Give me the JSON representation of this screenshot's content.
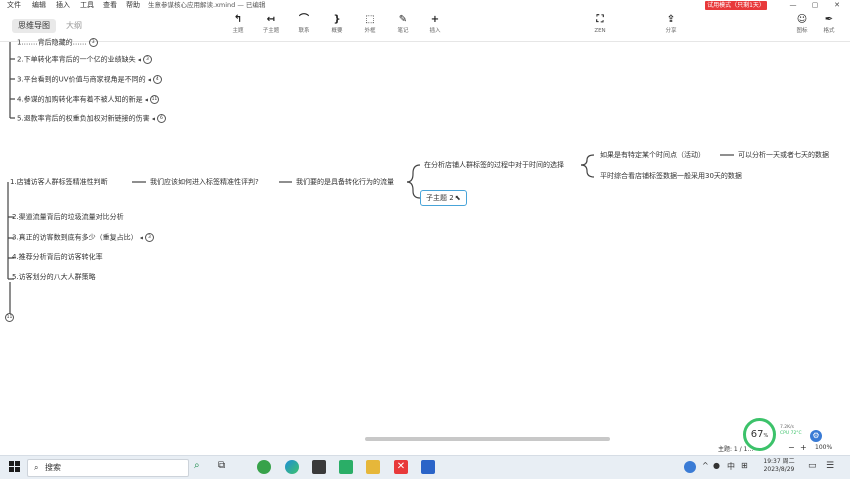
{
  "menubar": {
    "items": [
      "文件",
      "编辑",
      "插入",
      "工具",
      "查看",
      "帮助"
    ],
    "doc_title": "生意参谋核心应用解读.xmind — 已编辑",
    "trial_badge": "试用模式（只剩1天）",
    "window_controls": [
      "—",
      "▢",
      "✕"
    ]
  },
  "toolbar": {
    "tabs": [
      "思维导图",
      "大纲"
    ],
    "tools": [
      {
        "icon": "↰",
        "label": "主题"
      },
      {
        "icon": "↤",
        "label": "子主题"
      },
      {
        "icon": "⌒",
        "label": "联系"
      },
      {
        "icon": "}",
        "label": "概要"
      },
      {
        "icon": "⬚",
        "label": "外框"
      },
      {
        "icon": "✎",
        "label": "笔记"
      },
      {
        "icon": "+",
        "label": "插入"
      }
    ],
    "zen": {
      "icon": "⛶",
      "label": "ZEN"
    },
    "share": {
      "icon": "⇪",
      "label": "分享"
    },
    "right_tools": [
      {
        "icon": "☺",
        "label": "图标"
      },
      {
        "icon": "✒",
        "label": "格式"
      }
    ]
  },
  "mindmap": {
    "top_branch": [
      {
        "text": "1.……背后隐藏的……",
        "badge": "3"
      },
      {
        "text": "2.下单转化率背后的一个亿的业绩缺失",
        "badge": "3"
      },
      {
        "text": "3.平台看到的UV价值与商家视角是不同的",
        "badge": "4"
      },
      {
        "text": "4.参谋的加购转化率有着不被人知的新是",
        "badge": "11"
      },
      {
        "text": "5.退款率背后的权重负加权对新链接的伤害",
        "badge": "6"
      }
    ],
    "main_branch": [
      {
        "text": "1.店铺访客人群标签精准性判断",
        "badge": ""
      },
      {
        "text": "2.渠道流量背后的垃圾流量对比分析",
        "badge": ""
      },
      {
        "text": "3.真正的访客数到底有多少（重复占比）",
        "badge": "3"
      },
      {
        "text": "4.推荐分析背后的访客转化率",
        "badge": ""
      },
      {
        "text": "5.访客划分的八大人群策略",
        "badge": ""
      }
    ],
    "chain": [
      "我们应该如何进入标签精准性评判?",
      "我们要的是具备转化行为的流量",
      "在分析店铺人群标签的过程中对于时间的选择",
      "如果是有特定某个时间点（活动）",
      "可以分析一天或者七天的数据",
      "平时综合看店铺标签数据一般采用30天的数据"
    ],
    "selected_topic": "子主题 2",
    "collapsed_badge": "11"
  },
  "statusbar": {
    "topic_count": "主题: 1 / 1…",
    "zoom": "100%",
    "perf_percent": "67",
    "perf_unit": "%",
    "net_speed": "7.2K/s",
    "cpu": "CPU 72°C"
  },
  "taskbar": {
    "search_placeholder": "搜索",
    "clock_time": "19:37 周二",
    "clock_date": "2023/8/29",
    "ime": "中",
    "tray_items": [
      "^",
      "●",
      "中",
      "⊞"
    ]
  },
  "colors": {
    "trial_red": "#e8393a",
    "selection_blue": "#48a4d9",
    "gauge_green": "#3cc26a"
  }
}
